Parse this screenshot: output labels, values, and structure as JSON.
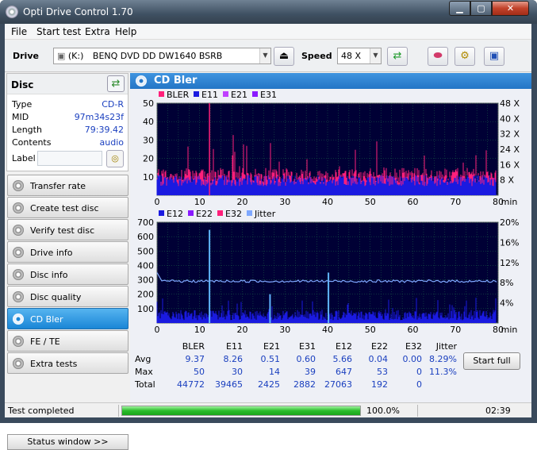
{
  "window": {
    "title": "Opti Drive Control 1.70",
    "min": "▁",
    "max": "▢",
    "close": "✕"
  },
  "menu": [
    "File",
    "Start test",
    "Extra",
    "Help"
  ],
  "toolbar": {
    "drive_label": "Drive",
    "drive_letter": "(K:)",
    "drive_name": "BENQ DVD DD DW1640 BSRB",
    "speed_label": "Speed",
    "speed_value": "48 X",
    "icons": [
      "eject-icon",
      "refresh-icon",
      "erase-icon",
      "settings-icon",
      "save-icon"
    ]
  },
  "disc": {
    "title": "Disc",
    "rows": [
      {
        "label": "Type",
        "value": "CD-R"
      },
      {
        "label": "MID",
        "value": "97m34s23f"
      },
      {
        "label": "Length",
        "value": "79:39.42"
      },
      {
        "label": "Contents",
        "value": "audio"
      }
    ],
    "label_label": "Label",
    "label_value": ""
  },
  "nav": [
    {
      "label": "Transfer rate",
      "active": false
    },
    {
      "label": "Create test disc",
      "active": false
    },
    {
      "label": "Verify test disc",
      "active": false
    },
    {
      "label": "Drive info",
      "active": false
    },
    {
      "label": "Disc info",
      "active": false
    },
    {
      "label": "Disc quality",
      "active": false
    },
    {
      "label": "CD Bler",
      "active": true
    },
    {
      "label": "FE / TE",
      "active": false
    },
    {
      "label": "Extra tests",
      "active": false
    }
  ],
  "status_window_label": "Status window >>",
  "main": {
    "title": "CD Bler",
    "start_button": "Start full"
  },
  "chart_data": [
    {
      "type": "bar",
      "legend": [
        {
          "name": "BLER",
          "color": "#ff1f7a"
        },
        {
          "name": "E11",
          "color": "#1a1ae0"
        },
        {
          "name": "E21",
          "color": "#c040ff"
        },
        {
          "name": "E31",
          "color": "#8a1aff"
        }
      ],
      "x_ticks": [
        0,
        10,
        20,
        30,
        40,
        50,
        60,
        70,
        80
      ],
      "x_unit": "min",
      "xlim": [
        0,
        80
      ],
      "ylim": [
        0,
        50
      ],
      "y_ticks": [
        10,
        20,
        30,
        40,
        50
      ],
      "y2_ticks": [
        "8 X",
        "16 X",
        "24 X",
        "32 X",
        "40 X",
        "48 X"
      ],
      "series_summary": {
        "BLER_typical": 10,
        "BLER_max": 50,
        "E11_typical": 8,
        "E11_max": 30
      }
    },
    {
      "type": "bar",
      "legend": [
        {
          "name": "E12",
          "color": "#1a1ae0"
        },
        {
          "name": "E22",
          "color": "#8a1aff"
        },
        {
          "name": "E32",
          "color": "#ff1f7a"
        },
        {
          "name": "Jitter",
          "color": "#7fa8ff"
        }
      ],
      "x_ticks": [
        0,
        10,
        20,
        30,
        40,
        50,
        60,
        70,
        80
      ],
      "x_unit": "min",
      "xlim": [
        0,
        80
      ],
      "ylim": [
        0,
        700
      ],
      "y_ticks": [
        100,
        200,
        300,
        400,
        500,
        600,
        700
      ],
      "y2_ticks": [
        "4%",
        "8%",
        "12%",
        "16%",
        "20%"
      ],
      "jitter_percent_typical": 8.3,
      "spikes": [
        {
          "x": 12.3,
          "value": 647
        },
        {
          "x": 26.5,
          "value": 200
        },
        {
          "x": 40.2,
          "value": 350
        }
      ]
    }
  ],
  "stats": {
    "columns": [
      "BLER",
      "E11",
      "E21",
      "E31",
      "E12",
      "E22",
      "E32",
      "Jitter"
    ],
    "rows": [
      {
        "label": "Avg",
        "values": [
          "9.37",
          "8.26",
          "0.51",
          "0.60",
          "5.66",
          "0.04",
          "0.00",
          "8.29%"
        ]
      },
      {
        "label": "Max",
        "values": [
          "50",
          "30",
          "14",
          "39",
          "647",
          "53",
          "0",
          "11.3%"
        ]
      },
      {
        "label": "Total",
        "values": [
          "44772",
          "39465",
          "2425",
          "2882",
          "27063",
          "192",
          "0",
          ""
        ]
      }
    ]
  },
  "statusbar": {
    "text": "Test completed",
    "progress": 100,
    "progress_text": "100.0%",
    "time": "02:39"
  }
}
